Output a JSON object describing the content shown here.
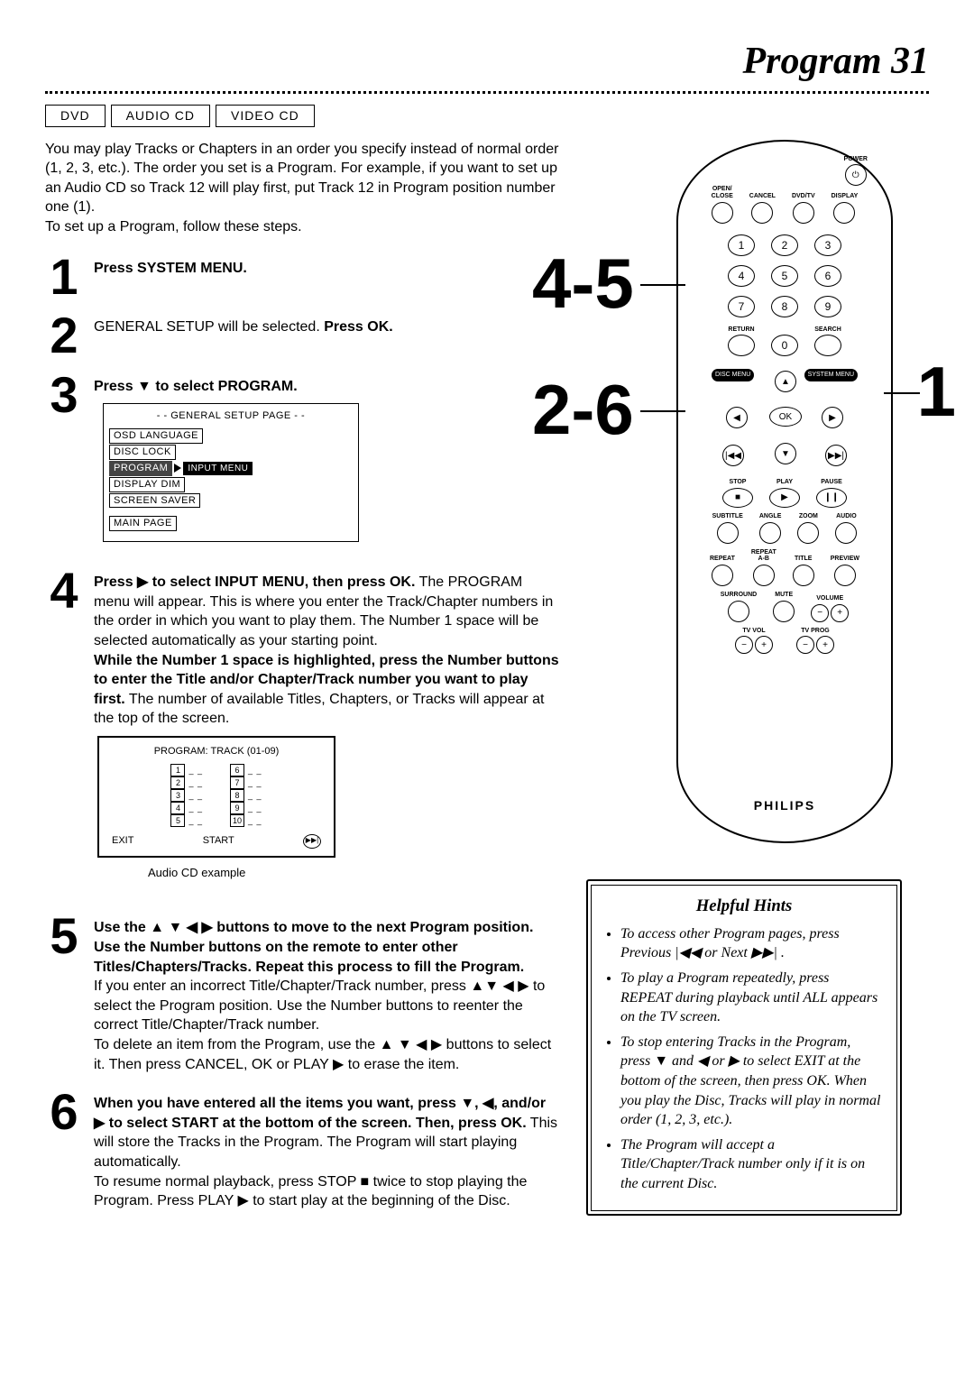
{
  "title": "Program 31",
  "media_tags": [
    "DVD",
    "AUDIO CD",
    "VIDEO CD"
  ],
  "intro": "You may play Tracks or Chapters in an order you specify instead of normal order (1, 2, 3, etc.). The order you set is a Program. For example, if you want to set up an Audio CD so Track 12 will play first, put Track 12 in Program position number one (1).\nTo set up a Program, follow these steps.",
  "steps": {
    "s1": {
      "num": "1",
      "body_bold": "Press SYSTEM MENU."
    },
    "s2": {
      "num": "2",
      "body_pre": "GENERAL SETUP will be selected. ",
      "body_bold": "Press OK."
    },
    "s3": {
      "num": "3",
      "body_bold": "Press ▼ to select PROGRAM."
    },
    "s4": {
      "num": "4",
      "body_bold1": "Press ▶ to select INPUT MENU, then press OK.",
      "body_p1": " The PROGRAM menu will appear. This is where you enter the Track/Chapter numbers in the order in which you want to play them. The Number 1 space will be selected automatically as your starting point.",
      "body_bold2": "While the Number 1 space is highlighted, press the Number buttons to enter the Title and/or Chapter/Track number you want to play first.",
      "body_p2": " The number of available Titles, Chapters, or Tracks will appear at the top of the screen."
    },
    "s5": {
      "num": "5",
      "body_bold": "Use the ▲ ▼ ◀ ▶ buttons to move to the next Program position. Use the Number buttons on the remote to enter other Titles/Chapters/Tracks. Repeat this process to fill the Program.",
      "body_p1": "If you enter an incorrect Title/Chapter/Track number, press ▲▼ ◀ ▶ to select the Program position. Use the Number buttons to reenter the correct Title/Chapter/Track number.",
      "body_p2": "To delete an item from the Program, use the ▲ ▼ ◀ ▶ buttons to select it. Then press CANCEL, OK or PLAY ▶ to erase the item."
    },
    "s6": {
      "num": "6",
      "body_bold1": "When you have entered all the items you want, press ▼, ◀, and/or ▶ to select START at the bottom of the screen. Then, press OK.",
      "body_p1": " This will store the Tracks in the Program. The Program will start playing automatically.",
      "body_p2": "To resume normal playback, press STOP ■ twice to stop playing the Program. Press PLAY ▶ to start play at the beginning of the Disc."
    }
  },
  "osd": {
    "header": "- -  GENERAL SETUP PAGE  - -",
    "items": [
      "OSD LANGUAGE",
      "DISC LOCK",
      "PROGRAM",
      "DISPLAY DIM",
      "SCREEN SAVER"
    ],
    "submenu": "INPUT MENU",
    "footer": "MAIN PAGE"
  },
  "program_panel": {
    "title": "PROGRAM: TRACK (01-09)",
    "left": [
      "1",
      "2",
      "3",
      "4",
      "5"
    ],
    "right": [
      "6",
      "7",
      "8",
      "9",
      "10"
    ],
    "exit": "EXIT",
    "start": "START"
  },
  "audio_cd_caption": "Audio CD example",
  "remote": {
    "power": "POWER",
    "row1": [
      "OPEN/\nCLOSE",
      "CANCEL",
      "DVD/TV",
      "DISPLAY"
    ],
    "numpad": [
      "1",
      "2",
      "3",
      "4",
      "5",
      "6",
      "7",
      "8",
      "9",
      "0"
    ],
    "return": "RETURN",
    "search": "SEARCH",
    "disc_menu": "DISC\nMENU",
    "system_menu": "SYSTEM\nMENU",
    "ok": "OK",
    "transport": {
      "stop": "STOP",
      "play": "PLAY",
      "pause": "PAUSE"
    },
    "row_a": [
      "SUBTITLE",
      "ANGLE",
      "ZOOM",
      "AUDIO"
    ],
    "row_b": [
      "REPEAT",
      "REPEAT\nA-B",
      "TITLE",
      "PREVIEW"
    ],
    "row_c": [
      "SURROUND",
      "MUTE",
      "",
      "VOLUME"
    ],
    "tv_vol": "TV VOL",
    "tv_prog": "TV PROG",
    "brand": "PHILIPS"
  },
  "callouts": {
    "a": "4-5",
    "b": "2-6",
    "c": "1"
  },
  "hints": {
    "title": "Helpful Hints",
    "items": [
      "To access other Program pages, press Previous |◀◀ or Next ▶▶| .",
      "To play a Program repeatedly, press REPEAT during playback until ALL appears on the TV screen.",
      "To stop entering Tracks in the Program, press ▼ and ◀ or ▶ to select EXIT at the bottom of the screen, then press OK. When you play the Disc, Tracks will play in normal order (1, 2, 3, etc.).",
      "The Program will accept a Title/Chapter/Track number only if it is on the current Disc."
    ]
  }
}
